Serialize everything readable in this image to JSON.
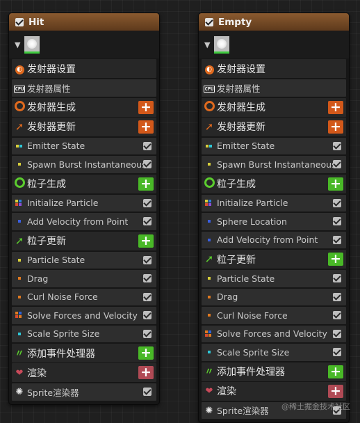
{
  "panels": [
    {
      "title": "Hit",
      "rows": [
        {
          "type": "big",
          "icon": "emitter-icon",
          "label": "发射器设置",
          "button": ""
        },
        {
          "type": "sub",
          "icon": "cpu-icon",
          "label": "发射器属性",
          "check": false
        },
        {
          "type": "big",
          "icon": "spawn-ring-icon",
          "label": "发射器生成",
          "button": "orange"
        },
        {
          "type": "big",
          "icon": "update-arrow-icon",
          "label": "发射器更新",
          "button": "orange"
        },
        {
          "type": "sub",
          "icon": "dots-yellow-cyan",
          "label": "Emitter State",
          "check": true
        },
        {
          "type": "sub",
          "icon": "dot-yellow",
          "label": "Spawn Burst Instantaneous",
          "check": true
        },
        {
          "type": "big",
          "icon": "particle-ring-icon",
          "label": "粒子生成",
          "button": "green"
        },
        {
          "type": "sub",
          "icon": "dots-multi",
          "label": "Initialize Particle",
          "check": true
        },
        {
          "type": "sub",
          "icon": "dot-blue",
          "label": "Add Velocity from Point",
          "check": true
        },
        {
          "type": "big",
          "icon": "particle-update-arrow-icon",
          "label": "粒子更新",
          "button": "green"
        },
        {
          "type": "sub",
          "icon": "dot-yellow",
          "label": "Particle State",
          "check": true
        },
        {
          "type": "sub",
          "icon": "dot-orange",
          "label": "Drag",
          "check": true
        },
        {
          "type": "sub",
          "icon": "dot-orange",
          "label": "Curl Noise Force",
          "check": true
        },
        {
          "type": "sub",
          "icon": "dots-orange-blue",
          "label": "Solve Forces and Velocity",
          "check": true
        },
        {
          "type": "sub",
          "icon": "dot-cyan",
          "label": "Scale Sprite Size",
          "check": true
        },
        {
          "type": "big",
          "icon": "event-handler-icon",
          "label": "添加事件处理器",
          "button": "green"
        },
        {
          "type": "big",
          "icon": "render-heart-icon",
          "label": "渲染",
          "button": "red"
        },
        {
          "type": "sub",
          "icon": "sprite-burst-icon",
          "label": "Sprite渲染器",
          "check": true
        }
      ]
    },
    {
      "title": "Empty",
      "rows": [
        {
          "type": "big",
          "icon": "emitter-icon",
          "label": "发射器设置",
          "button": ""
        },
        {
          "type": "sub",
          "icon": "cpu-icon",
          "label": "发射器属性",
          "check": false
        },
        {
          "type": "big",
          "icon": "spawn-ring-icon",
          "label": "发射器生成",
          "button": "orange"
        },
        {
          "type": "big",
          "icon": "update-arrow-icon",
          "label": "发射器更新",
          "button": "orange"
        },
        {
          "type": "sub",
          "icon": "dots-yellow-cyan",
          "label": "Emitter State",
          "check": true
        },
        {
          "type": "sub",
          "icon": "dot-yellow",
          "label": "Spawn Burst Instantaneous",
          "check": true
        },
        {
          "type": "big",
          "icon": "particle-ring-icon",
          "label": "粒子生成",
          "button": "green"
        },
        {
          "type": "sub",
          "icon": "dots-multi",
          "label": "Initialize Particle",
          "check": true
        },
        {
          "type": "sub",
          "icon": "dot-blue",
          "label": "Sphere Location",
          "check": true
        },
        {
          "type": "sub",
          "icon": "dot-blue",
          "label": "Add Velocity from Point",
          "check": true
        },
        {
          "type": "big",
          "icon": "particle-update-arrow-icon",
          "label": "粒子更新",
          "button": "green"
        },
        {
          "type": "sub",
          "icon": "dot-yellow",
          "label": "Particle State",
          "check": true
        },
        {
          "type": "sub",
          "icon": "dot-orange",
          "label": "Drag",
          "check": true
        },
        {
          "type": "sub",
          "icon": "dot-orange",
          "label": "Curl Noise Force",
          "check": true
        },
        {
          "type": "sub",
          "icon": "dots-orange-blue",
          "label": "Solve Forces and Velocity",
          "check": true
        },
        {
          "type": "sub",
          "icon": "dot-cyan",
          "label": "Scale Sprite Size",
          "check": true
        },
        {
          "type": "big",
          "icon": "event-handler-icon",
          "label": "添加事件处理器",
          "button": "green"
        },
        {
          "type": "big",
          "icon": "render-heart-icon",
          "label": "渲染",
          "button": "red"
        },
        {
          "type": "sub",
          "icon": "sprite-burst-icon",
          "label": "Sprite渲染器",
          "check": true
        }
      ]
    }
  ],
  "colors": {
    "header": "#7a4d26",
    "orange_button": "#d2581a",
    "green_button": "#49b827",
    "red_button": "#b04a55",
    "thumbnail_bar": "#3ecb3e"
  },
  "watermark": "@稀土掘金技术社区"
}
